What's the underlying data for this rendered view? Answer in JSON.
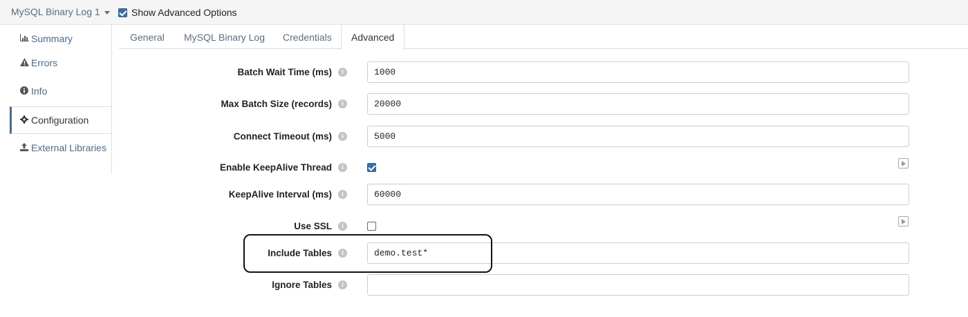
{
  "topbar": {
    "stage_name": "MySQL Binary Log 1",
    "show_advanced_label": "Show Advanced Options",
    "show_advanced_checked": true
  },
  "nav": {
    "items": [
      {
        "label": "Summary",
        "icon": "bar-chart-icon"
      },
      {
        "label": "Errors",
        "icon": "warning-icon"
      },
      {
        "label": "Info",
        "icon": "info-icon"
      },
      {
        "label": "Configuration",
        "icon": "gear-icon",
        "active": true
      },
      {
        "label": "External Libraries",
        "icon": "upload-icon"
      }
    ]
  },
  "tabs": [
    {
      "label": "General"
    },
    {
      "label": "MySQL Binary Log"
    },
    {
      "label": "Credentials"
    },
    {
      "label": "Advanced",
      "active": true
    }
  ],
  "form": {
    "batch_wait_time": {
      "label": "Batch Wait Time (ms)",
      "value": "1000"
    },
    "max_batch_size": {
      "label": "Max Batch Size (records)",
      "value": "20000"
    },
    "connect_timeout": {
      "label": "Connect Timeout (ms)",
      "value": "5000"
    },
    "enable_keepalive": {
      "label": "Enable KeepAlive Thread",
      "checked": true
    },
    "keepalive_interval": {
      "label": "KeepAlive Interval (ms)",
      "value": "60000"
    },
    "use_ssl": {
      "label": "Use SSL",
      "checked": false
    },
    "include_tables": {
      "label": "Include Tables",
      "value": "demo.test*"
    },
    "ignore_tables": {
      "label": "Ignore Tables",
      "value": ""
    }
  },
  "colors": {
    "accent": "#3c6fa6",
    "nav_text": "#4a6a88",
    "highlight_border": "#111111"
  }
}
